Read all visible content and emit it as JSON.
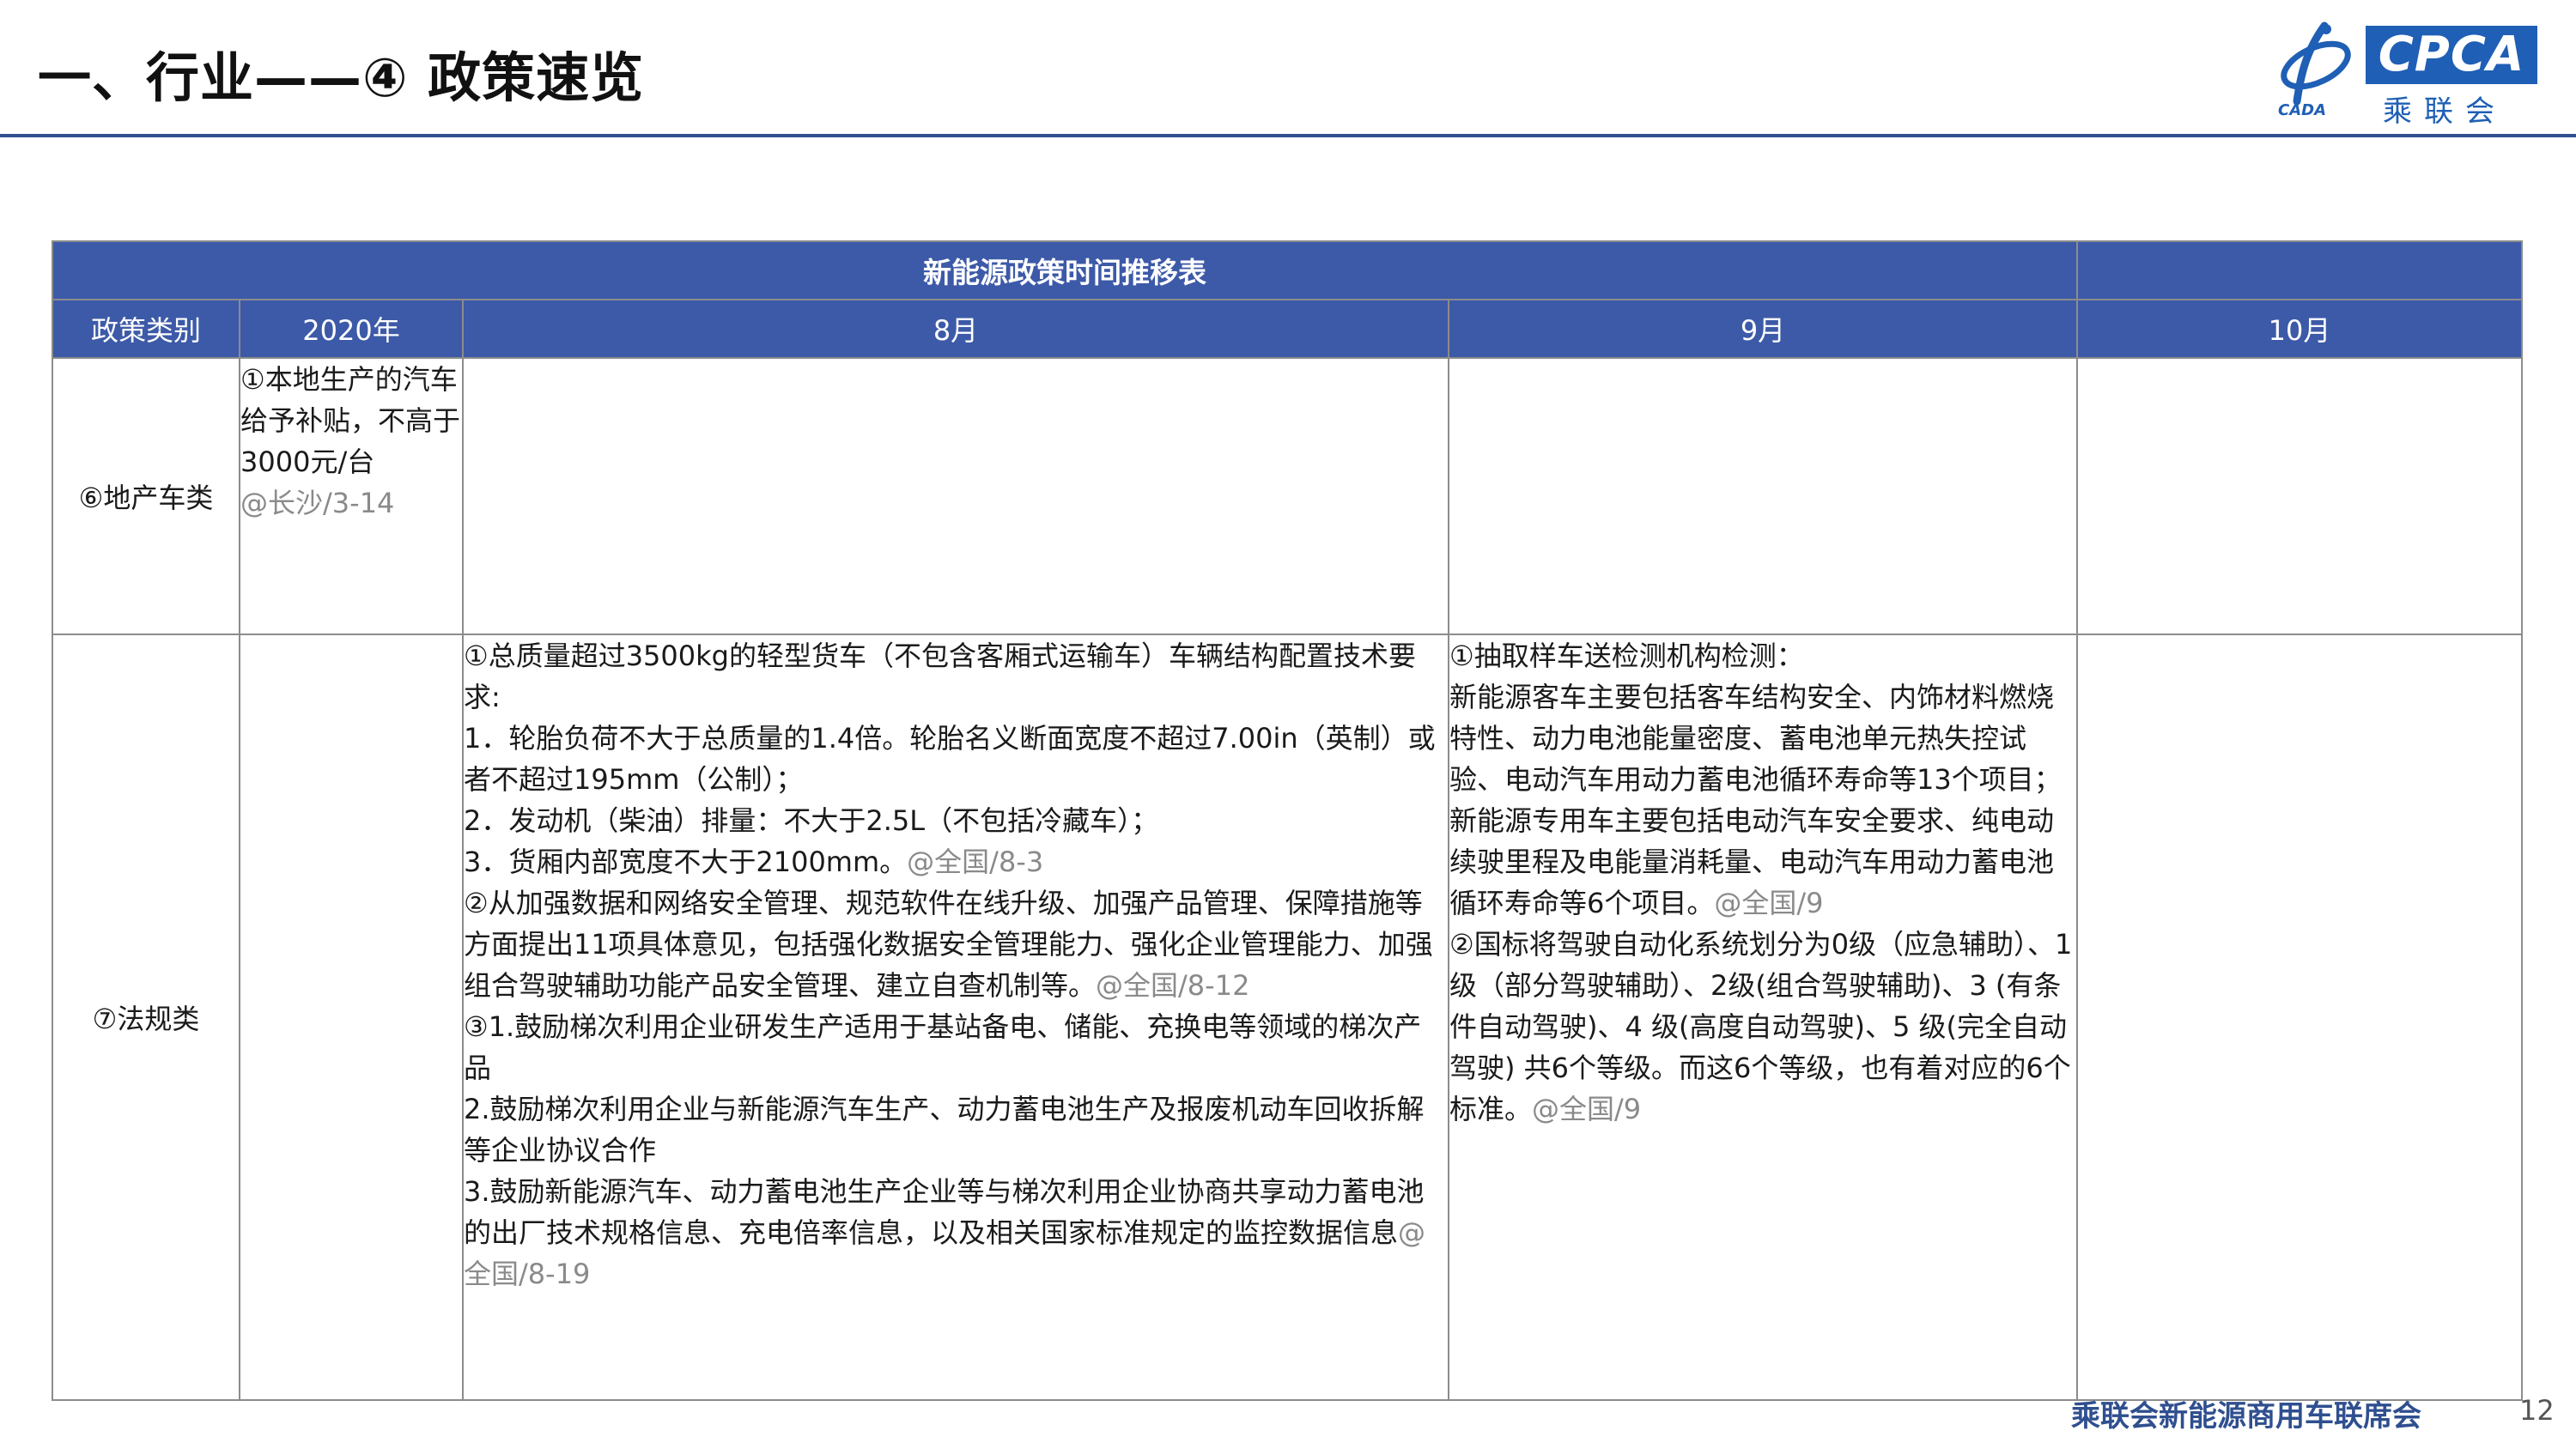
{
  "header": {
    "title": "一、行业——④ 政策速览",
    "logo_text": "CPCA",
    "logo_sub": "乘联会",
    "logo_tag": "CADA",
    "rule_color": "#2f4f8f"
  },
  "table": {
    "title": "新能源政策时间推移表",
    "columns": [
      "政策类别",
      "2020年",
      "8月",
      "9月",
      "10月"
    ],
    "header_bg": "#3d5aa8",
    "rows": [
      {
        "category": "⑥地产车类",
        "y2020": {
          "text": "①本地生产的汽车给予补贴，不高于3000元/台",
          "ref": "@长沙/3-14"
        },
        "aug": [],
        "sep": [],
        "oct": []
      },
      {
        "category": "⑦法规类",
        "y2020": {},
        "aug": [
          {
            "text": "①总质量超过3500kg的轻型货车（不包含客厢式运输车）车辆结构配置技术要求:"
          },
          {
            "text": "1．轮胎负荷不大于总质量的1.4倍。轮胎名义断面宽度不超过7.00in（英制）或者不超过195mm（公制）；"
          },
          {
            "text": "2．发动机（柴油）排量：不大于2.5L（不包括冷藏车）；"
          },
          {
            "text": "3．货厢内部宽度不大于2100mm。",
            "ref": "@全国/8-3"
          },
          {
            "text": "②从加强数据和网络安全管理、规范软件在线升级、加强产品管理、保障措施等方面提出11项具体意见，包括强化数据安全管理能力、强化企业管理能力、加强组合驾驶辅助功能产品安全管理、建立自查机制等。",
            "ref": "@全国/8-12"
          },
          {
            "text": "③1.鼓励梯次利用企业研发生产适用于基站备电、储能、充换电等领域的梯次产品"
          },
          {
            "text": "2.鼓励梯次利用企业与新能源汽车生产、动力蓄电池生产及报废机动车回收拆解等企业协议合作"
          },
          {
            "text": "3.鼓励新能源汽车、动力蓄电池生产企业等与梯次利用企业协商共享动力蓄电池的出厂技术规格信息、充电倍率信息，以及相关国家标准规定的监控数据信息",
            "ref": "@全国/8-19"
          }
        ],
        "sep": [
          {
            "text": "①抽取样车送检测机构检测："
          },
          {
            "text": "新能源客车主要包括客车结构安全、内饰材料燃烧特性、动力电池能量密度、蓄电池单元热失控试验、电动汽车用动力蓄电池循环寿命等13个项目；新能源专用车主要包括电动汽车安全要求、纯电动续驶里程及电能量消耗量、电动汽车用动力蓄电池循环寿命等6个项目。",
            "ref": "@全国/9"
          },
          {
            "text": "②国标将驾驶自动化系统划分为0级（应急辅助）、1级（部分驾驶辅助）、2级(组合驾驶辅助)、3 (有条件自动驾驶)、4 级(高度自动驾驶)、5 级(完全自动驾驶) 共6个等级。而这6个等级，也有着对应的6个标准。",
            "ref": "@全国/9"
          }
        ],
        "oct": []
      }
    ]
  },
  "footer": {
    "org": "乘联会新能源商用车联席会",
    "page": "12"
  }
}
